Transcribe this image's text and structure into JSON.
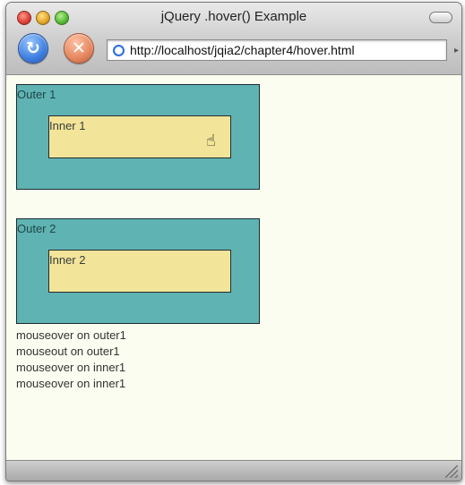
{
  "window": {
    "title": "jQuery .hover() Example"
  },
  "toolbar": {
    "reload_icon": "reload-icon",
    "stop_icon": "stop-icon",
    "url": "http://localhost/jqia2/chapter4/hover.html"
  },
  "content": {
    "outer1": {
      "label": "Outer 1",
      "inner_label": "Inner 1"
    },
    "outer2": {
      "label": "Outer 2",
      "inner_label": "Inner 2"
    },
    "log": [
      "mouseover on outer1",
      "mouseout on outer1",
      "mouseover on inner1",
      "mouseover on inner1"
    ]
  },
  "colors": {
    "page_background": "#fbfdf0",
    "outer_fill": "#5fb3b3",
    "inner_fill": "#f2e59a"
  }
}
